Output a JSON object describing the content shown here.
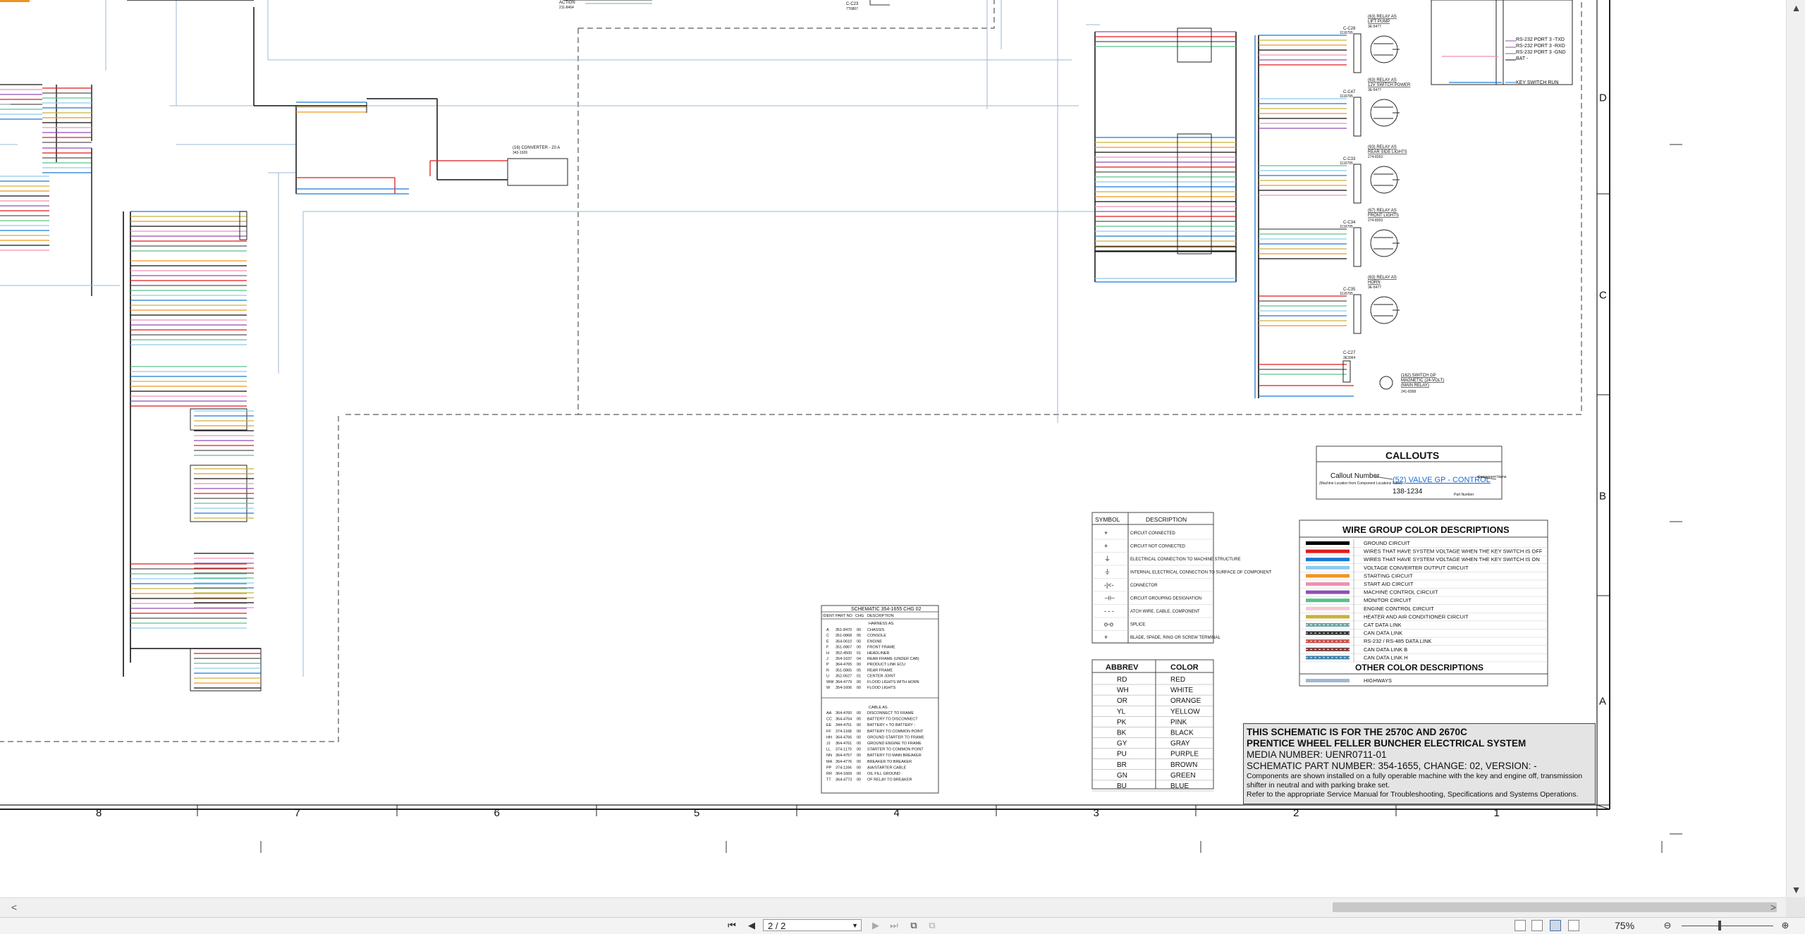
{
  "title_block": {
    "line1": "THIS SCHEMATIC IS FOR THE 2570C AND 2670C",
    "line2": "PRENTICE WHEEL FELLER BUNCHER ELECTRICAL SYSTEM",
    "media": "MEDIA NUMBER: UENR0711-01",
    "part": "SCHEMATIC PART NUMBER: 354-1655, CHANGE: 02, VERSION: -",
    "note1": "Components are shown installed on a fully operable machine with the key and engine off, transmission shifter in neutral and with parking brake set.",
    "note2": "Refer to the appropriate Service Manual for Troubleshooting, Specifications and Systems Operations."
  },
  "callouts": {
    "title": "CALLOUTS",
    "callout_number": "Callout Number",
    "callout_sub": "(Machine Location from Component Locations Table)",
    "example_name": "(52) VALVE GP - CONTROL",
    "example_part": "138-1234",
    "component_name": "Component Name",
    "part_number": "Part Number"
  },
  "wire_colors": {
    "title": "WIRE GROUP COLOR DESCRIPTIONS",
    "items": [
      {
        "color": "#000000",
        "label": "GROUND CIRCUIT"
      },
      {
        "color": "#e31b1b",
        "label": "WIRES THAT HAVE SYSTEM VOLTAGE WHEN THE KEY SWITCH IS OFF"
      },
      {
        "color": "#1a7ad4",
        "label": "WIRES THAT HAVE SYSTEM VOLTAGE WHEN THE KEY SWITCH IS ON"
      },
      {
        "color": "#8ec9ef",
        "label": "VOLTAGE CONVERTER OUTPUT CIRCUIT"
      },
      {
        "color": "#f0941f",
        "label": "STARTING CIRCUIT"
      },
      {
        "color": "#f08fb0",
        "label": "START AID CIRCUIT"
      },
      {
        "color": "#8e4fb4",
        "label": "MACHINE CONTROL CIRCUIT"
      },
      {
        "color": "#5cc08b",
        "label": "MONITOR CIRCUIT"
      },
      {
        "color": "#f3cad8",
        "label": "ENGINE CONTROL CIRCUIT"
      },
      {
        "color": "#c9b23a",
        "label": "HEATER AND AIR CONDITIONER CIRCUIT"
      },
      {
        "color": "#6aa5a5",
        "label": "CAT DATA LINK"
      },
      {
        "color": "#2d2d2d",
        "label": "CAN DATA LINK"
      },
      {
        "color": "#c84a4a",
        "label": "RS-232 / RS-485 DATA LINK"
      },
      {
        "color": "#7a3a3a",
        "label": "CAN DATA LINK B"
      },
      {
        "color": "#3d7fa8",
        "label": "CAN DATA LINK H"
      }
    ],
    "other_title": "OTHER COLOR DESCRIPTIONS",
    "other_items": [
      {
        "color": "#9bbad6",
        "label": "HIGHWAYS"
      }
    ]
  },
  "symbols": {
    "header_symbol": "SYMBOL",
    "header_desc": "DESCRIPTION",
    "items": [
      {
        "sym": "+",
        "desc": "CIRCUIT CONNECTED"
      },
      {
        "sym": "+",
        "desc": "CIRCUIT NOT CONNECTED"
      },
      {
        "sym": "⏚",
        "desc": "ELECTRICAL CONNECTION TO MACHINE STRUCTURE"
      },
      {
        "sym": "⏚",
        "desc": "INTERNAL ELECTRICAL CONNECTION TO SURFACE OF COMPONENT"
      },
      {
        "sym": "-|<-",
        "desc": "CONNECTOR"
      },
      {
        "sym": "⊣⊢",
        "desc": "CIRCUIT GROUPING DESIGNATION"
      },
      {
        "sym": "- - -",
        "desc": "ATCH WIRE, CABLE, COMPONENT"
      },
      {
        "sym": "o-o",
        "desc": "SPLICE"
      },
      {
        "sym": "+",
        "desc": "BLADE, SPADE, RING OR SCREW TERMINAL"
      }
    ]
  },
  "abbrev": {
    "header_abbrev": "ABBREV",
    "header_color": "COLOR",
    "items": [
      {
        "a": "RD",
        "c": "RED"
      },
      {
        "a": "WH",
        "c": "WHITE"
      },
      {
        "a": "OR",
        "c": "ORANGE"
      },
      {
        "a": "YL",
        "c": "YELLOW"
      },
      {
        "a": "PK",
        "c": "PINK"
      },
      {
        "a": "BK",
        "c": "BLACK"
      },
      {
        "a": "GY",
        "c": "GRAY"
      },
      {
        "a": "PU",
        "c": "PURPLE"
      },
      {
        "a": "BR",
        "c": "BROWN"
      },
      {
        "a": "GN",
        "c": "GREEN"
      },
      {
        "a": "BU",
        "c": "BLUE"
      }
    ]
  },
  "harness": {
    "title": "SCHEMATIC 354-1655 CHG 02",
    "col_ident": "IDENT",
    "col_part": "PART NO",
    "col_chg": "CHG",
    "col_desc": "DESCRIPTION",
    "section1": "HARNESS AS.",
    "rows1": [
      [
        "A",
        "351-8470",
        "00",
        "CHASSIS"
      ],
      [
        "C",
        "351-0868",
        "05",
        "CONSOLE"
      ],
      [
        "E",
        "364-0610",
        "00",
        "ENGINE"
      ],
      [
        "F",
        "351-0867",
        "00",
        "FRONT FRAME"
      ],
      [
        "H",
        "352-4500",
        "01",
        "HEADLINER"
      ],
      [
        "J",
        "354-1637",
        "04",
        "REAR FRAME (UNDER CAB)"
      ],
      [
        "P",
        "364-4765",
        "00",
        "PRODUCT LINK ECU"
      ],
      [
        "R",
        "351-0865",
        "05",
        "REAR FRAME"
      ],
      [
        "U",
        "352-0627",
        "01",
        "CENTER JOINT"
      ],
      [
        "WW",
        "364-4779",
        "00",
        "FLOOD LIGHTS WITH HORN"
      ],
      [
        "W",
        "354-1606",
        "00",
        "FLOOD LIGHTS"
      ]
    ],
    "section2": "CABLE AS.",
    "rows2": [
      [
        "AA",
        "364-4760",
        "00",
        "DISCONNECT TO FRAME"
      ],
      [
        "CC",
        "364-4764",
        "00",
        "BATTERY TO DISCONNECT"
      ],
      [
        "EE",
        "344-4751",
        "00",
        "BATTERY + TO BATTERY -"
      ],
      [
        "FF",
        "374-1168",
        "00",
        "BATTERY TO COMMON POINT"
      ],
      [
        "HH",
        "364-4766",
        "00",
        "GROUND STARTER TO FRAME"
      ],
      [
        "JJ",
        "364-4761",
        "00",
        "GROUND ENGINE TO FRAME"
      ],
      [
        "LL",
        "374-1170",
        "00",
        "STARTER TO COMMON POINT"
      ],
      [
        "NN",
        "364-4757",
        "00",
        "BATTERY TO MAIN BREAKER"
      ],
      [
        "MA",
        "364-4776",
        "00",
        "BREAKER TO BREAKER"
      ],
      [
        "PP",
        "374-1166",
        "00",
        "AIA/STARTER CABLE"
      ],
      [
        "RR",
        "364-1669",
        "00",
        "OIL FILL GROUND"
      ],
      [
        "TT",
        "364-4773",
        "00",
        "OF RELAY TO BREAKER"
      ]
    ]
  },
  "zones": [
    "8",
    "7",
    "6",
    "5",
    "4",
    "3",
    "2",
    "1"
  ],
  "rows_side": [
    "D",
    "C",
    "B",
    "A"
  ],
  "relays": [
    {
      "callout": "(63) RELAY AS",
      "name": "LIFT PUMP",
      "part": "3E-5477",
      "conn": "C-C28",
      "cpart": "1116795"
    },
    {
      "callout": "(63) RELAY AS",
      "name": "12V SWITCH POWER",
      "part": "3E-5477",
      "conn": "C-C47",
      "cpart": "1116795"
    },
    {
      "callout": "(63) RELAY AS",
      "name": "REAR SIDE LIGHTS",
      "part": "274-8353",
      "conn": "C-C33",
      "cpart": "1116795"
    },
    {
      "callout": "(67) RELAY AS",
      "name": "FRONT LIGHTS",
      "part": "274-8353",
      "conn": "C-C34",
      "cpart": "1116795"
    },
    {
      "callout": "(63) RELAY AS",
      "name": "HORN",
      "part": "3E-5477",
      "conn": "C-C35",
      "cpart": "1116795"
    }
  ],
  "switch_gp": {
    "callout": "(162) SWITCH GP",
    "name": "MAGNETIC (24-VOLT)",
    "name2": "(MAIN RELAY)",
    "part": "241-8368",
    "conn": "C-C27",
    "cpart": "3E3364"
  },
  "converter": {
    "name": "(16) CONVERTER - 20 A",
    "part": "343-1926"
  },
  "top_labels": {
    "action": "ACTION",
    "action_part": "211-8464",
    "cc23": "C-C23",
    "cc23_part": "7T6867"
  },
  "rs232": {
    "p1": "RS-232 PORT 3 -TXD",
    "p2": "RS-232 PORT 3 -RXD",
    "p3": "RS-232 PORT 3 -GND",
    "p4": "BAT -",
    "p5": "KEY SWITCH RUN"
  },
  "status": {
    "page_value": "2 / 2",
    "zoom": "75%"
  }
}
